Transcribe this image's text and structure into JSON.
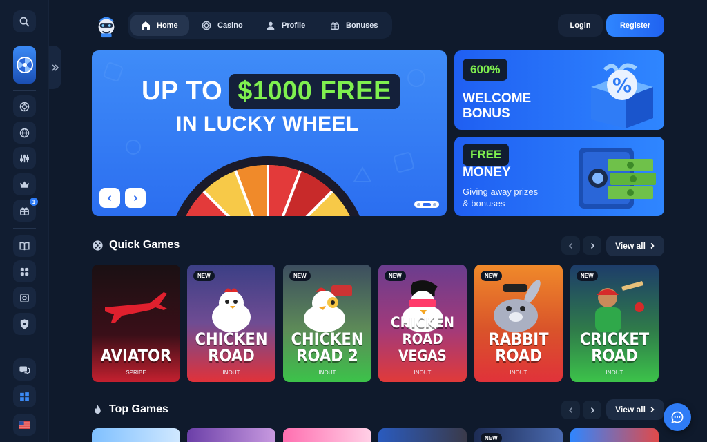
{
  "nav": {
    "items": [
      {
        "label": "Home",
        "icon": "home-icon",
        "active": true
      },
      {
        "label": "Casino",
        "icon": "casino-chip-icon",
        "active": false
      },
      {
        "label": "Profile",
        "icon": "user-icon",
        "active": false
      },
      {
        "label": "Bonuses",
        "icon": "gift-icon",
        "active": false
      }
    ]
  },
  "auth": {
    "login_label": "Login",
    "register_label": "Register"
  },
  "sidebar": {
    "icons": [
      "search-icon",
      "lucky-wheel-icon",
      "casino-chip-icon",
      "globe-icon",
      "sliders-icon",
      "crown-icon",
      "gift-icon",
      "book-icon",
      "game-controller-icon",
      "vault-icon",
      "shield-icon",
      "chat-bubbles-icon",
      "windows-icon",
      "us-flag-icon"
    ],
    "gift_badge": "1"
  },
  "hero": {
    "line1_prefix": "UP TO",
    "line1_highlight": "$1000 FREE",
    "line2": "IN LUCKY WHEEL"
  },
  "promos": [
    {
      "tag": "600%",
      "title": "WELCOME BONUS"
    },
    {
      "tag": "FREE",
      "title": "MONEY",
      "subtitle": "Giving away prizes & bonuses"
    }
  ],
  "quick_games": {
    "title": "Quick Games",
    "view_all_label": "View all",
    "games": [
      {
        "name": "AVIATOR",
        "provider": "SPRIBE",
        "is_new": false
      },
      {
        "name": "CHICKEN ROAD",
        "provider": "INOUT",
        "is_new": true
      },
      {
        "name": "CHICKEN ROAD 2",
        "provider": "INOUT",
        "is_new": true
      },
      {
        "name": "CHICKEN ROAD VEGAS",
        "provider": "INOUT",
        "is_new": true
      },
      {
        "name": "RABBIT ROAD",
        "provider": "INOUT",
        "is_new": true
      },
      {
        "name": "CRICKET ROAD",
        "provider": "INOUT",
        "is_new": true
      }
    ],
    "new_badge_label": "NEW"
  },
  "top_games": {
    "title": "Top Games",
    "view_all_label": "View all",
    "new_badge_label": "NEW"
  },
  "colors": {
    "accent_blue": "#2f7cf6",
    "highlight_green": "#7ff04f",
    "background": "#0f1a2c"
  }
}
